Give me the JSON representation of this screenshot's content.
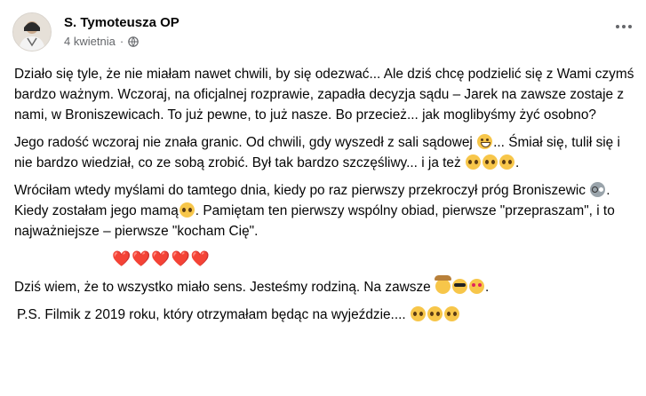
{
  "post": {
    "author": "S. Tymoteusza OP",
    "date": "4 kwietnia",
    "separator": "·",
    "privacy_icon": "globe-icon",
    "more_icon": "three-dots-icon"
  },
  "paragraphs": {
    "p1": "Działo się tyle, że nie miałam nawet chwili, by się odezwać... Ale dziś chcę podzielić się z Wami czymś bardzo ważnym. Wczoraj, na oficjalnej rozprawie, zapadła decyzja sądu – Jarek na zawsze zostaje z nami, w Broniszewicach. To już pewne, to już nasze. Bo przecież... jak moglibyśmy żyć osobno?",
    "p2a": "Jego radość wczoraj nie znała granic. Od chwili, gdy wyszedł z sali sądowej",
    "p2b": "... Śmiał się, tulił się i nie bardzo wiedział, co ze sobą zrobić. Był tak bardzo szczęśliwy... i ja też",
    "p2c": ".",
    "p3a": "Wróciłam wtedy myślami do tamtego dnia, kiedy po raz pierwszy przekroczył próg Broniszewic",
    "p3b": ". Kiedy zostałam jego mamą",
    "p3c": ". Pamiętam ten pierwszy wspólny obiad, pierwsze \"przepraszam\", i to najważniejsze – pierwsze \"kocham Cię\".",
    "hearts": "❤️❤️❤️❤️❤️",
    "p4": "Dziś wiem, że to wszystko miało sens. Jesteśmy rodziną. Na zawsze",
    "p4end": ".",
    "p5": "P.S. Filmik z 2019 roku, który otrzymałam będąc na wyjeździe...."
  }
}
